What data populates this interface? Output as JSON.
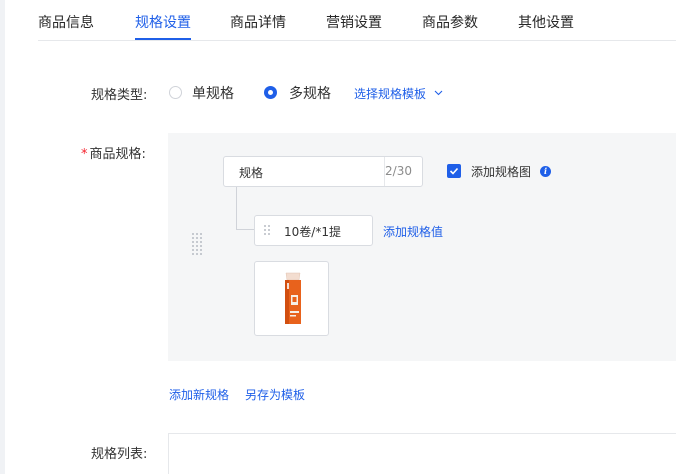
{
  "tabs": [
    {
      "label": "商品信息",
      "active": false
    },
    {
      "label": "规格设置",
      "active": true
    },
    {
      "label": "商品详情",
      "active": false
    },
    {
      "label": "营销设置",
      "active": false
    },
    {
      "label": "商品参数",
      "active": false
    },
    {
      "label": "其他设置",
      "active": false
    }
  ],
  "spec_type": {
    "label": "规格类型:",
    "options": [
      {
        "label": "单规格",
        "selected": false
      },
      {
        "label": "多规格",
        "selected": true
      }
    ],
    "template_link": "选择规格模板",
    "template_icon": "chevron-down-icon"
  },
  "product_spec": {
    "required_mark": "*",
    "label": "商品规格:",
    "spec_name": {
      "value": "规格",
      "counter": "2/30"
    },
    "add_image_checkbox": {
      "label": "添加规格图",
      "checked": true,
      "icon": "info-icon"
    },
    "values": [
      {
        "value": "10卷/*1提",
        "image": "product-thumbnail"
      }
    ],
    "add_value_link": "添加规格值"
  },
  "actions": {
    "add_spec": "添加新规格",
    "save_template": "另存为模板"
  },
  "spec_list": {
    "label": "规格列表:"
  },
  "colors": {
    "accent": "#1f5fe8",
    "required": "#f5222d",
    "spec_area_bg": "#f5f6f7",
    "product_orange": "#e8621c"
  }
}
